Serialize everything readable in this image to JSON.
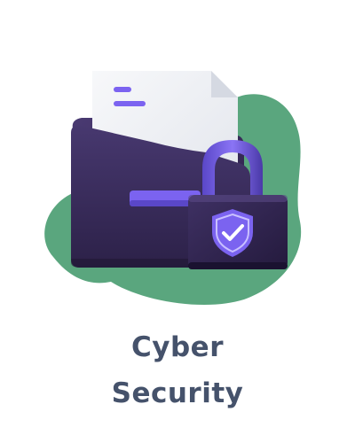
{
  "card": {
    "title_line1": "Cyber",
    "title_line2": "Security"
  },
  "illustration": {
    "icons": [
      "folder-icon",
      "document-icon",
      "padlock-icon",
      "shield-check-icon"
    ],
    "colors": {
      "blob": "#5aa67e",
      "folder": "#3a2b5c",
      "accent": "#7b63f0",
      "paper": "#eef0f4",
      "text": "#45526b"
    }
  }
}
